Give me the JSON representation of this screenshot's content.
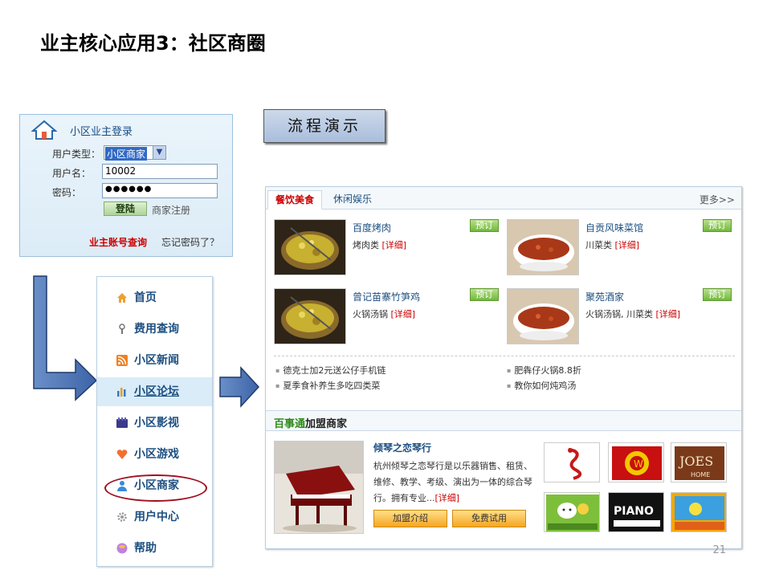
{
  "slide": {
    "title": "业主核心应用3：社区商圈",
    "page_number": "21"
  },
  "login": {
    "title": "小区业主登录",
    "user_type_label": "用户类型：",
    "user_type_value": "小区商家",
    "username_label": "用户名：",
    "username_value": "10002",
    "password_label": "密码：",
    "password_value": "●●●●●●",
    "login_button": "登陆",
    "register_link": "商家注册",
    "account_query": "业主账号查询",
    "forgot_password": "忘记密码了？"
  },
  "demo_button": "流程演示",
  "nav": {
    "items": [
      {
        "label": "首页",
        "icon": "home-icon"
      },
      {
        "label": "费用查询",
        "icon": "key-icon"
      },
      {
        "label": "小区新闻",
        "icon": "rss-icon"
      },
      {
        "label": "小区论坛",
        "icon": "bar-chart-icon"
      },
      {
        "label": "小区影视",
        "icon": "film-icon"
      },
      {
        "label": "小区游戏",
        "icon": "heart-icon"
      },
      {
        "label": "小区商家",
        "icon": "user-icon"
      },
      {
        "label": "用户中心",
        "icon": "gear-icon"
      },
      {
        "label": "帮助",
        "icon": "help-icon"
      }
    ]
  },
  "main": {
    "tabs": [
      {
        "label": "餐饮美食"
      },
      {
        "label": "休闲娱乐"
      }
    ],
    "more": "更多>>",
    "foods": [
      {
        "name": "百度烤肉",
        "category": "烤肉类",
        "detail": "[详细]",
        "book": "预订"
      },
      {
        "name": "自贡风味菜馆",
        "category": "川菜类",
        "detail": "[详细]",
        "book": "预订"
      },
      {
        "name": "曾记苗寨竹笋鸡",
        "category": "火锅汤锅",
        "detail": "[详细]",
        "book": "预订"
      },
      {
        "name": "聚苑酒家",
        "category": "火锅汤锅, 川菜类",
        "detail": "[详细]",
        "book": "预订"
      }
    ],
    "news": [
      "德克士加2元送公仔手机链",
      "肥犇仔火锅8.8折",
      "夏季食补养生多吃四类菜",
      "教你如何炖鸡汤"
    ],
    "merchant_section": {
      "brand": "百事通",
      "title": "加盟商家"
    },
    "shop": {
      "name": "倾琴之恋琴行",
      "description": "杭州倾琴之恋琴行是以乐器销售、租赁、维修、教学、考级、演出为一体的综合琴行。拥有专业...",
      "detail": "[详细]",
      "join_button": "加盟介绍",
      "trial_button": "免费试用"
    },
    "logos": [
      "dragon-logo",
      "wuliangye-logo",
      "joes-home-logo",
      "sheep-logo",
      "piano-logo",
      "city-logo"
    ]
  },
  "colors": {
    "accent_blue": "#1d4f80",
    "red": "#cc0000",
    "green": "#73b83d",
    "orange": "#f5a623"
  }
}
